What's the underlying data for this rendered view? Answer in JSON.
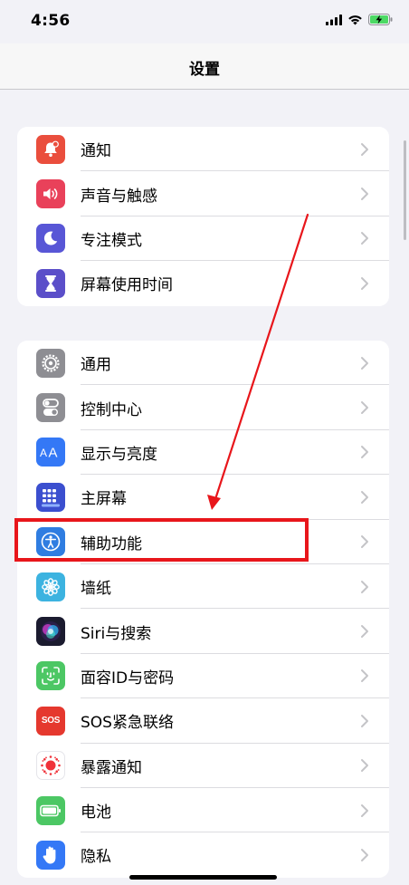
{
  "status": {
    "time": "4:56"
  },
  "nav": {
    "title": "设置"
  },
  "groups": [
    {
      "items": [
        {
          "label": "通知",
          "icon": "bell-icon",
          "color": "#ea4e3d"
        },
        {
          "label": "声音与触感",
          "icon": "speaker-icon",
          "color": "#e9415a"
        },
        {
          "label": "专注模式",
          "icon": "moon-icon",
          "color": "#5856d6"
        },
        {
          "label": "屏幕使用时间",
          "icon": "hourglass-icon",
          "color": "#5b4fc9"
        }
      ]
    },
    {
      "items": [
        {
          "label": "通用",
          "icon": "gear-icon",
          "color": "#8e8e93"
        },
        {
          "label": "控制中心",
          "icon": "toggles-icon",
          "color": "#8e8e93"
        },
        {
          "label": "显示与亮度",
          "icon": "text-size-icon",
          "color": "#3478f6"
        },
        {
          "label": "主屏幕",
          "icon": "home-grid-icon",
          "color": "#3b4fcf"
        },
        {
          "label": "辅助功能",
          "icon": "accessibility-icon",
          "color": "#2f7de1"
        },
        {
          "label": "墙纸",
          "icon": "flower-icon",
          "color": "#3cb3e0"
        },
        {
          "label": "Siri与搜索",
          "icon": "siri-icon",
          "color": "#1b1b2f"
        },
        {
          "label": "面容ID与密码",
          "icon": "face-id-icon",
          "color": "#4cc764"
        },
        {
          "label": "SOS紧急联络",
          "icon": "sos-icon",
          "color": "#e5382e",
          "icon_text": "SOS"
        },
        {
          "label": "暴露通知",
          "icon": "exposure-icon",
          "color": "#ffffff"
        },
        {
          "label": "电池",
          "icon": "battery-icon",
          "color": "#4cc764"
        },
        {
          "label": "隐私",
          "icon": "hand-icon",
          "color": "#3478f6"
        }
      ]
    }
  ],
  "annotation": {
    "highlight_color": "#e8161b"
  }
}
